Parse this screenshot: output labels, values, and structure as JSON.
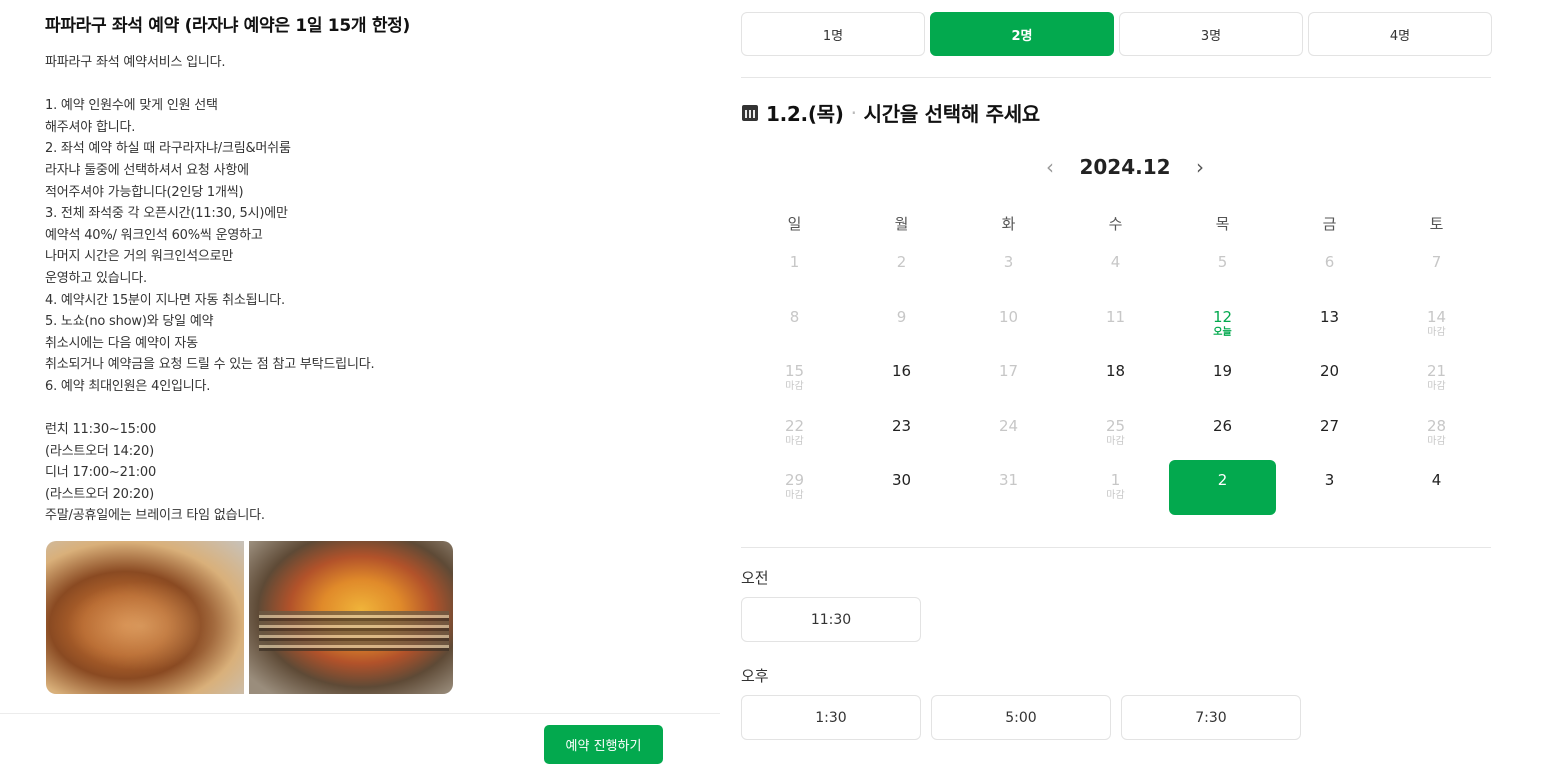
{
  "product": {
    "title": "파파라구 좌석 예약 (라자냐 예약은 1일 15개 한정)",
    "description_lines": [
      "파파라구 좌석 예약서비스 입니다.",
      "",
      "1. 예약 인원수에 맞게 인원 선택",
      "해주셔야 합니다.",
      "2. 좌석 예약 하실 때 라구라자냐/크림&머쉬룸",
      "라자냐 둘중에 선택하셔서 요청 사항에",
      "적어주셔야 가능합니다(2인당 1개씩)",
      "3. 전체 좌석중 각 오픈시간(11:30, 5시)에만",
      "예약석 40%/ 워크인석 60%씩 운영하고",
      "나머지 시간은 거의 워크인석으로만",
      "운영하고 있습니다.",
      "4. 예약시간 15분이 지나면 자동 취소됩니다.",
      "5. 노쇼(no show)와 당일 예약",
      "취소시에는 다음 예약이 자동",
      "취소되거나 예약금을 요청 드릴 수 있는 점 참고 부탁드립니다.",
      "6. 예약 최대인원은 4인입니다.",
      "",
      "런치 11:30~15:00",
      "(라스트오더 14:20)",
      "디너 17:00~21:00",
      "(라스트오더 20:20)",
      "주말/공휴일에는 브레이크 타임 없습니다."
    ]
  },
  "footer": {
    "proceed_label": "예약 진행하기"
  },
  "people": {
    "options": [
      "1명",
      "2명",
      "3명",
      "4명"
    ],
    "selected_index": 1
  },
  "selection": {
    "date_label": "1.2.(목)",
    "prompt": "시간을 선택해 주세요"
  },
  "calendar": {
    "month_label": "2024.12",
    "weekdays": [
      "일",
      "월",
      "화",
      "수",
      "목",
      "금",
      "토"
    ],
    "weeks": [
      [
        {
          "n": "1",
          "s": "past"
        },
        {
          "n": "2",
          "s": "past"
        },
        {
          "n": "3",
          "s": "past"
        },
        {
          "n": "4",
          "s": "past"
        },
        {
          "n": "5",
          "s": "past"
        },
        {
          "n": "6",
          "s": "past"
        },
        {
          "n": "7",
          "s": "past"
        }
      ],
      [
        {
          "n": "8",
          "s": "past"
        },
        {
          "n": "9",
          "s": "past"
        },
        {
          "n": "10",
          "s": "past"
        },
        {
          "n": "11",
          "s": "past"
        },
        {
          "n": "12",
          "s": "today",
          "sub": "오늘"
        },
        {
          "n": "13",
          "s": "avail"
        },
        {
          "n": "14",
          "s": "past",
          "sub": "마감"
        }
      ],
      [
        {
          "n": "15",
          "s": "past",
          "sub": "마감"
        },
        {
          "n": "16",
          "s": "avail"
        },
        {
          "n": "17",
          "s": "past"
        },
        {
          "n": "18",
          "s": "avail"
        },
        {
          "n": "19",
          "s": "avail"
        },
        {
          "n": "20",
          "s": "avail"
        },
        {
          "n": "21",
          "s": "past",
          "sub": "마감"
        }
      ],
      [
        {
          "n": "22",
          "s": "past",
          "sub": "마감"
        },
        {
          "n": "23",
          "s": "avail"
        },
        {
          "n": "24",
          "s": "past"
        },
        {
          "n": "25",
          "s": "past",
          "sub": "마감"
        },
        {
          "n": "26",
          "s": "avail"
        },
        {
          "n": "27",
          "s": "avail"
        },
        {
          "n": "28",
          "s": "past",
          "sub": "마감"
        }
      ],
      [
        {
          "n": "29",
          "s": "past",
          "sub": "마감"
        },
        {
          "n": "30",
          "s": "avail"
        },
        {
          "n": "31",
          "s": "past"
        },
        {
          "n": "1",
          "s": "past",
          "sub": "마감"
        },
        {
          "n": "2",
          "s": "selected"
        },
        {
          "n": "3",
          "s": "avail"
        },
        {
          "n": "4",
          "s": "avail"
        }
      ]
    ]
  },
  "times": {
    "am_label": "오전",
    "am_slots": [
      "11:30"
    ],
    "pm_label": "오후",
    "pm_slots": [
      "1:30",
      "5:00",
      "7:30"
    ]
  }
}
